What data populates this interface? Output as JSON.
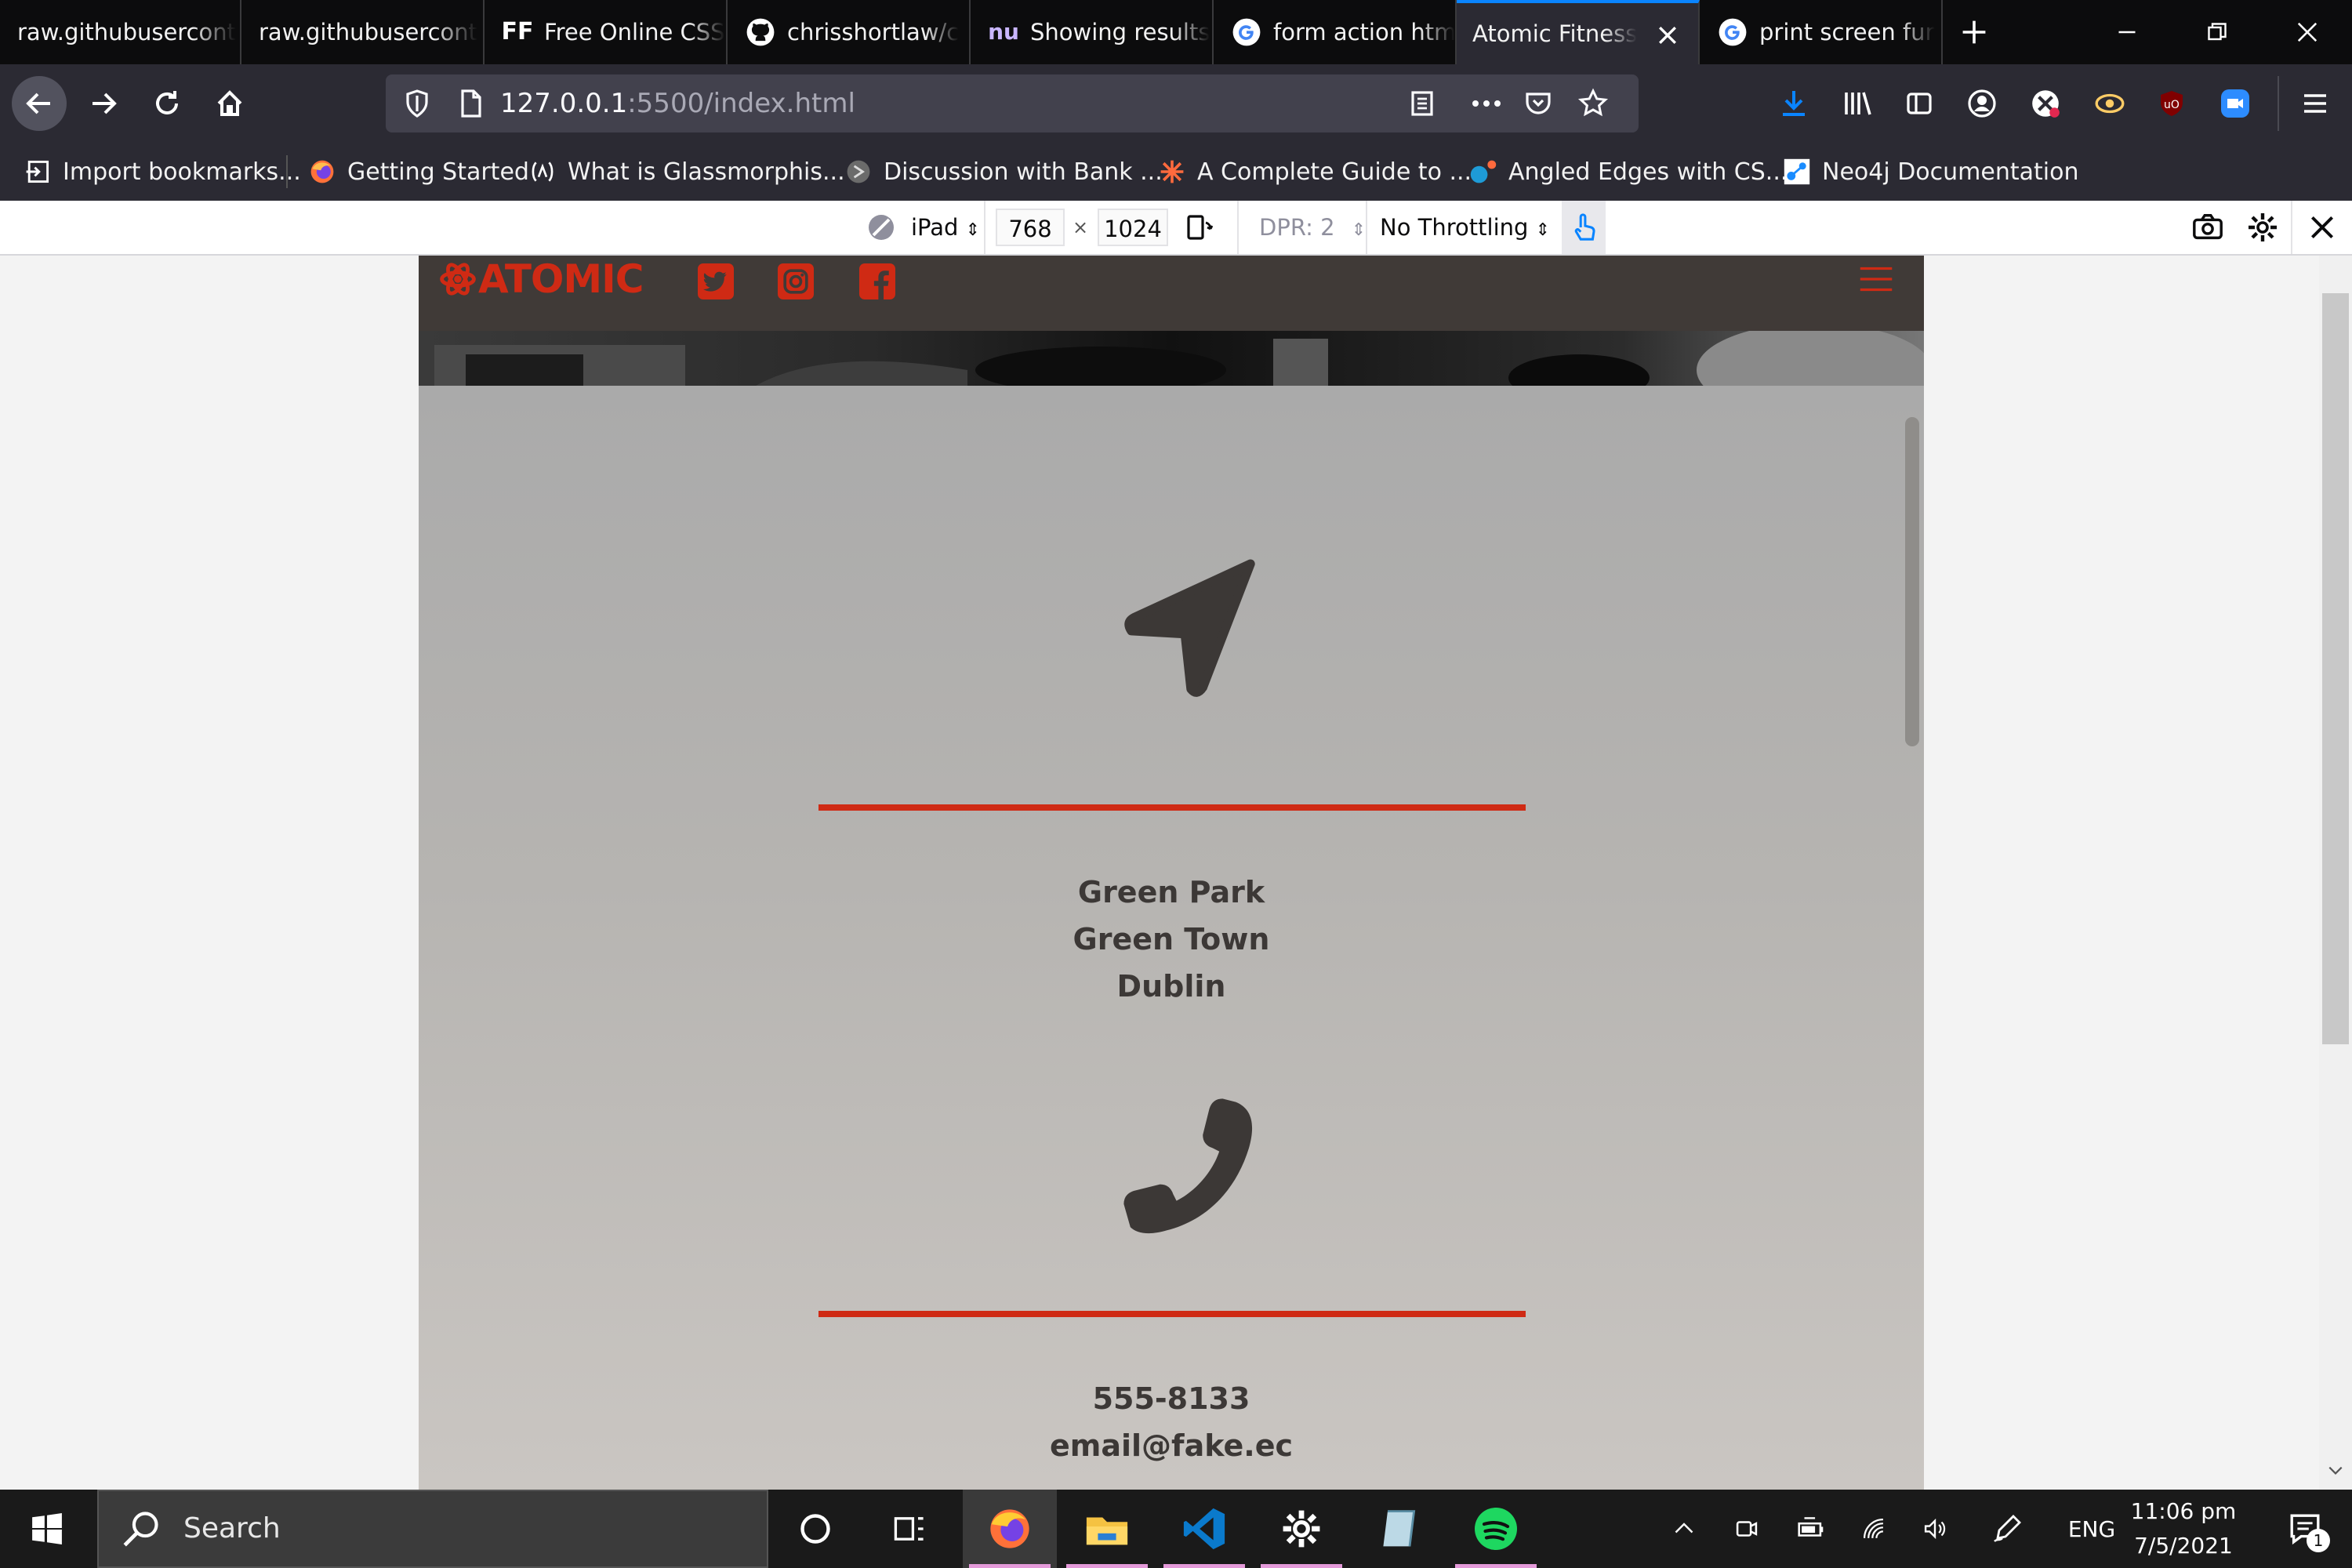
{
  "browser": {
    "tabs": [
      {
        "title": "raw.githubusercont",
        "icon": "none"
      },
      {
        "title": "raw.githubusercont",
        "icon": "none"
      },
      {
        "title": "Free Online CSS",
        "icon": "ff-logo",
        "badge": "FF"
      },
      {
        "title": "chrisshortlaw/c",
        "icon": "github-icon"
      },
      {
        "title": "Showing results",
        "icon": "nu-logo",
        "badge": "nu"
      },
      {
        "title": "form action htm",
        "icon": "google-icon"
      },
      {
        "title": "Atomic Fitness |",
        "icon": "none",
        "active": true
      },
      {
        "title": "print screen fur",
        "icon": "google-icon"
      }
    ],
    "url": {
      "host": "127.0.0.1",
      "rest": ":5500/index.html"
    },
    "bookmarks": [
      {
        "label": "Import bookmarks...",
        "icon": "import-icon"
      },
      {
        "label": "Getting Started",
        "icon": "firefox-icon"
      },
      {
        "label": "What is Glassmorphis...",
        "icon": "code-icon"
      },
      {
        "label": "Discussion with Bank ...",
        "icon": "discussion-icon"
      },
      {
        "label": "A Complete Guide to ...",
        "icon": "star-burst-icon"
      },
      {
        "label": "Angled Edges with CS...",
        "icon": "dots-icon"
      },
      {
        "label": "Neo4j Documentation",
        "icon": "neo4j-icon"
      }
    ]
  },
  "responsive_toolbar": {
    "device": "iPad",
    "width": "768",
    "times": "×",
    "height": "1024",
    "dpr": "DPR: 2",
    "throttling": "No Throttling"
  },
  "site": {
    "logo": "ATOMIC",
    "address": [
      "Green Park",
      "Green Town",
      "Dublin"
    ],
    "contact": [
      "555-8133",
      "email@fake.ec"
    ],
    "colors": {
      "accent": "#cf2a14",
      "nav_bg": "#403a37",
      "icon_dark": "#3c3836"
    }
  },
  "taskbar": {
    "search_placeholder": "Search",
    "language": "ENG",
    "time": "11:06 pm",
    "date": "7/5/2021",
    "notifications": "1"
  }
}
